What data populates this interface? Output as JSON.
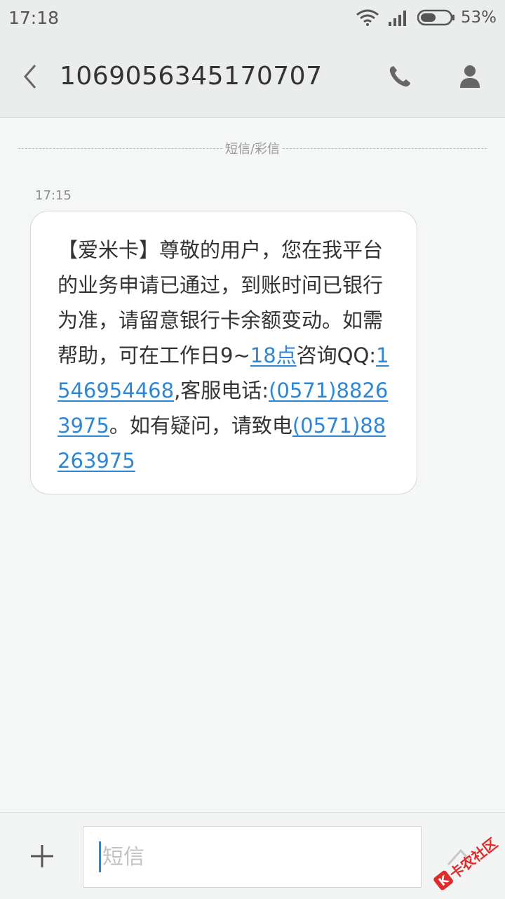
{
  "status_bar": {
    "time": "17:18",
    "battery_percent": "53%",
    "battery_level": 0.53,
    "icons": [
      "wifi-icon",
      "signal-icon",
      "battery-icon"
    ]
  },
  "header": {
    "title": "1069056345170707",
    "back_icon": "chevron-left-icon",
    "call_icon": "phone-icon",
    "contact_icon": "person-icon"
  },
  "divider_label": "短信/彩信",
  "message": {
    "time": "17:15",
    "segments": [
      {
        "text": "【爱米卡】尊敬的用户，您在我平台的业务申请已通过，到账时间已银行为准，请留意银行卡余额变动。如需帮助，可在工作日9~",
        "link": false
      },
      {
        "text": "18点",
        "link": true
      },
      {
        "text": "咨询QQ:",
        "link": false
      },
      {
        "text": "1546954468",
        "link": true
      },
      {
        "text": ",客服电话:",
        "link": false
      },
      {
        "text": "(0571)88263975",
        "link": true
      },
      {
        "text": "。如有疑问，请致电",
        "link": false
      },
      {
        "text": "(0571)88263975",
        "link": true
      }
    ]
  },
  "composer": {
    "add_icon": "plus-icon",
    "placeholder": "短信",
    "value": "",
    "send_icon": "send-icon"
  },
  "watermark": {
    "logo_letter": "K",
    "text": "卡农社区"
  },
  "colors": {
    "link": "#2e86d6",
    "background": "#f5f6f6",
    "header_bg": "#ebecec",
    "watermark": "#e02b2b"
  }
}
